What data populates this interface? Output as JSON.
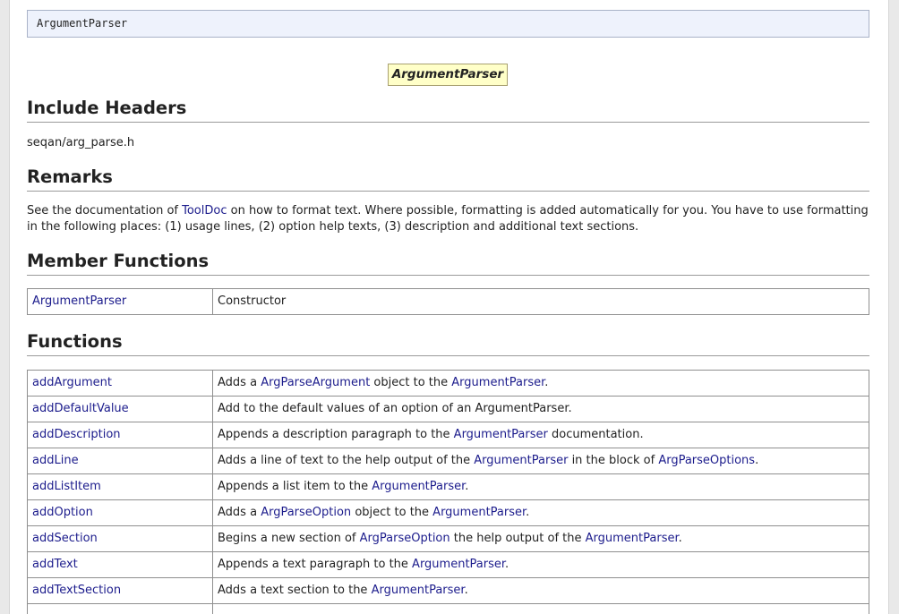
{
  "signature": "ArgumentParser",
  "diagram_label": "ArgumentParser",
  "sections": {
    "include": {
      "heading": "Include Headers",
      "path": "seqan/arg_parse.h"
    },
    "remarks": {
      "heading": "Remarks",
      "text_before": "See the documentation of ",
      "link": "ToolDoc",
      "text_after": " on how to format text. Where possible, formatting is added automatically for you. You have to use formatting in the following places: (1) usage lines, (2) option help texts, (3) description and additional text sections."
    },
    "members": {
      "heading": "Member Functions",
      "rows": [
        {
          "name": "ArgumentParser",
          "desc": "Constructor"
        }
      ]
    },
    "functions": {
      "heading": "Functions",
      "rows": [
        {
          "name": "addArgument",
          "desc": [
            {
              "t": "Adds a "
            },
            {
              "t": "ArgParseArgument",
              "link": true
            },
            {
              "t": " object to the "
            },
            {
              "t": "ArgumentParser",
              "link": true
            },
            {
              "t": "."
            }
          ]
        },
        {
          "name": "addDefaultValue",
          "desc": [
            {
              "t": "Add to the default values of an option of an ArgumentParser."
            }
          ]
        },
        {
          "name": "addDescription",
          "desc": [
            {
              "t": "Appends a description paragraph to the "
            },
            {
              "t": "ArgumentParser",
              "link": true
            },
            {
              "t": " documentation."
            }
          ]
        },
        {
          "name": "addLine",
          "desc": [
            {
              "t": "Adds a line of text to the help output of the "
            },
            {
              "t": "ArgumentParser",
              "link": true
            },
            {
              "t": " in the block of "
            },
            {
              "t": "ArgParseOptions",
              "link": true
            },
            {
              "t": "."
            }
          ]
        },
        {
          "name": "addListItem",
          "desc": [
            {
              "t": "Appends a list item to the "
            },
            {
              "t": "ArgumentParser",
              "link": true
            },
            {
              "t": "."
            }
          ]
        },
        {
          "name": "addOption",
          "desc": [
            {
              "t": "Adds a "
            },
            {
              "t": "ArgParseOption",
              "link": true
            },
            {
              "t": " object to the "
            },
            {
              "t": "ArgumentParser",
              "link": true
            },
            {
              "t": "."
            }
          ]
        },
        {
          "name": "addSection",
          "desc": [
            {
              "t": "Begins a new section of "
            },
            {
              "t": "ArgParseOption",
              "link": true
            },
            {
              "t": " the help output of the "
            },
            {
              "t": "ArgumentParser",
              "link": true
            },
            {
              "t": "."
            }
          ]
        },
        {
          "name": "addText",
          "desc": [
            {
              "t": "Appends a text paragraph to the "
            },
            {
              "t": "ArgumentParser",
              "link": true
            },
            {
              "t": "."
            }
          ]
        },
        {
          "name": "addTextSection",
          "desc": [
            {
              "t": "Adds a text section to the "
            },
            {
              "t": "ArgumentParser",
              "link": true
            },
            {
              "t": "."
            }
          ]
        },
        {
          "name": "",
          "desc": [
            {
              "t": ""
            }
          ]
        }
      ]
    }
  },
  "colors": {
    "link": "#1c1c8c",
    "codebox_bg": "#eef2fc",
    "diagram_bg": "#ffffc8"
  }
}
